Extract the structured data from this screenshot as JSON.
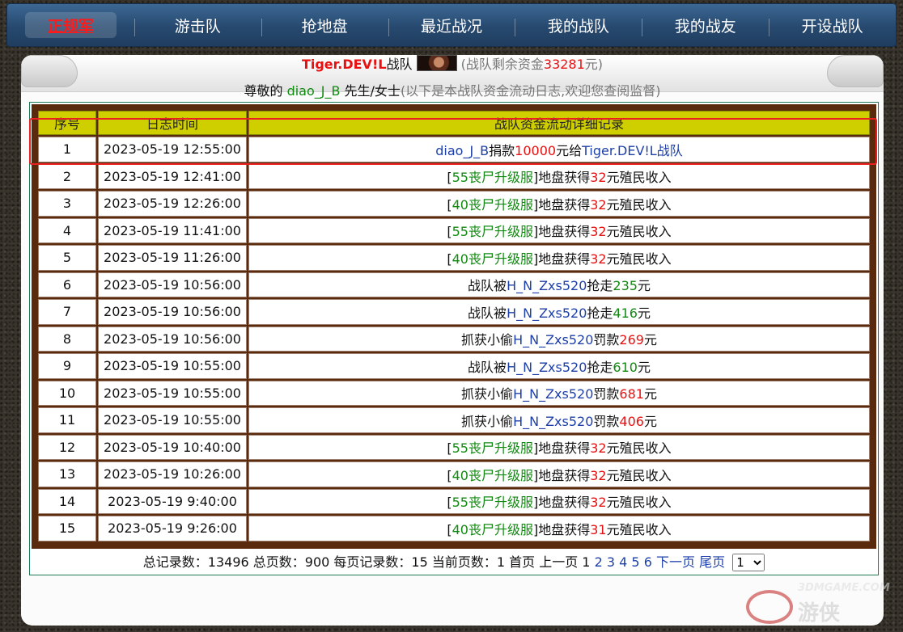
{
  "nav": {
    "items": [
      {
        "label": "正规军",
        "active": true
      },
      {
        "label": "游击队"
      },
      {
        "label": "抢地盘"
      },
      {
        "label": "最近战况"
      },
      {
        "label": "我的战队"
      },
      {
        "label": "我的战友"
      },
      {
        "label": "开设战队"
      }
    ]
  },
  "header": {
    "team_name": "Tiger.DEV!L",
    "team_suffix": "战队",
    "funds_prefix": "(战队剩余资金",
    "funds_value": "33281",
    "funds_suffix": "元)"
  },
  "greeting": {
    "prefix": "尊敬的 ",
    "user": "diao_J_B",
    "mid": " 先生/女士",
    "note": "(以下是本战队资金流动日志,欢迎您查阅监督)"
  },
  "table": {
    "headers": [
      "序号",
      "日志时间",
      "战队资金流动详细记录"
    ],
    "rows": [
      {
        "idx": "1",
        "time": "2023-05-19 12:55:00",
        "parts": [
          {
            "t": "diao_J_B",
            "c": "blue"
          },
          {
            "t": "捐款",
            "c": ""
          },
          {
            "t": "10000",
            "c": "red"
          },
          {
            "t": "元给",
            "c": ""
          },
          {
            "t": "Tiger.DEV!L战队",
            "c": "blue"
          }
        ]
      },
      {
        "idx": "2",
        "time": "2023-05-19 12:41:00",
        "parts": [
          {
            "t": "[",
            "c": ""
          },
          {
            "t": "55丧尸升级服",
            "c": "green"
          },
          {
            "t": "]地盘获得",
            "c": ""
          },
          {
            "t": "32",
            "c": "red"
          },
          {
            "t": "元殖民收入",
            "c": ""
          }
        ]
      },
      {
        "idx": "3",
        "time": "2023-05-19 12:26:00",
        "parts": [
          {
            "t": "[",
            "c": ""
          },
          {
            "t": "40丧尸升级服",
            "c": "green"
          },
          {
            "t": "]地盘获得",
            "c": ""
          },
          {
            "t": "32",
            "c": "red"
          },
          {
            "t": "元殖民收入",
            "c": ""
          }
        ]
      },
      {
        "idx": "4",
        "time": "2023-05-19 11:41:00",
        "parts": [
          {
            "t": "[",
            "c": ""
          },
          {
            "t": "55丧尸升级服",
            "c": "green"
          },
          {
            "t": "]地盘获得",
            "c": ""
          },
          {
            "t": "32",
            "c": "red"
          },
          {
            "t": "元殖民收入",
            "c": ""
          }
        ]
      },
      {
        "idx": "5",
        "time": "2023-05-19 11:26:00",
        "parts": [
          {
            "t": "[",
            "c": ""
          },
          {
            "t": "40丧尸升级服",
            "c": "green"
          },
          {
            "t": "]地盘获得",
            "c": ""
          },
          {
            "t": "32",
            "c": "red"
          },
          {
            "t": "元殖民收入",
            "c": ""
          }
        ]
      },
      {
        "idx": "6",
        "time": "2023-05-19 10:56:00",
        "parts": [
          {
            "t": "战队被",
            "c": ""
          },
          {
            "t": "H_N_Zxs520",
            "c": "blue"
          },
          {
            "t": "抢走",
            "c": ""
          },
          {
            "t": "235",
            "c": "green"
          },
          {
            "t": "元",
            "c": ""
          }
        ]
      },
      {
        "idx": "7",
        "time": "2023-05-19 10:56:00",
        "parts": [
          {
            "t": "战队被",
            "c": ""
          },
          {
            "t": "H_N_Zxs520",
            "c": "blue"
          },
          {
            "t": "抢走",
            "c": ""
          },
          {
            "t": "416",
            "c": "green"
          },
          {
            "t": "元",
            "c": ""
          }
        ]
      },
      {
        "idx": "8",
        "time": "2023-05-19 10:56:00",
        "parts": [
          {
            "t": "抓获小偷",
            "c": ""
          },
          {
            "t": "H_N_Zxs520",
            "c": "blue"
          },
          {
            "t": "罚款",
            "c": ""
          },
          {
            "t": "269",
            "c": "red"
          },
          {
            "t": "元",
            "c": ""
          }
        ]
      },
      {
        "idx": "9",
        "time": "2023-05-19 10:55:00",
        "parts": [
          {
            "t": "战队被",
            "c": ""
          },
          {
            "t": "H_N_Zxs520",
            "c": "blue"
          },
          {
            "t": "抢走",
            "c": ""
          },
          {
            "t": "610",
            "c": "green"
          },
          {
            "t": "元",
            "c": ""
          }
        ]
      },
      {
        "idx": "10",
        "time": "2023-05-19 10:55:00",
        "parts": [
          {
            "t": "抓获小偷",
            "c": ""
          },
          {
            "t": "H_N_Zxs520",
            "c": "blue"
          },
          {
            "t": "罚款",
            "c": ""
          },
          {
            "t": "681",
            "c": "red"
          },
          {
            "t": "元",
            "c": ""
          }
        ]
      },
      {
        "idx": "11",
        "time": "2023-05-19 10:55:00",
        "parts": [
          {
            "t": "抓获小偷",
            "c": ""
          },
          {
            "t": "H_N_Zxs520",
            "c": "blue"
          },
          {
            "t": "罚款",
            "c": ""
          },
          {
            "t": "406",
            "c": "red"
          },
          {
            "t": "元",
            "c": ""
          }
        ]
      },
      {
        "idx": "12",
        "time": "2023-05-19 10:40:00",
        "parts": [
          {
            "t": "[",
            "c": ""
          },
          {
            "t": "55丧尸升级服",
            "c": "green"
          },
          {
            "t": "]地盘获得",
            "c": ""
          },
          {
            "t": "32",
            "c": "red"
          },
          {
            "t": "元殖民收入",
            "c": ""
          }
        ]
      },
      {
        "idx": "13",
        "time": "2023-05-19 10:26:00",
        "parts": [
          {
            "t": "[",
            "c": ""
          },
          {
            "t": "40丧尸升级服",
            "c": "green"
          },
          {
            "t": "]地盘获得",
            "c": ""
          },
          {
            "t": "32",
            "c": "red"
          },
          {
            "t": "元殖民收入",
            "c": ""
          }
        ]
      },
      {
        "idx": "14",
        "time": "2023-05-19 9:40:00",
        "parts": [
          {
            "t": "[",
            "c": ""
          },
          {
            "t": "55丧尸升级服",
            "c": "green"
          },
          {
            "t": "]地盘获得",
            "c": ""
          },
          {
            "t": "32",
            "c": "red"
          },
          {
            "t": "元殖民收入",
            "c": ""
          }
        ]
      },
      {
        "idx": "15",
        "time": "2023-05-19 9:26:00",
        "parts": [
          {
            "t": "[",
            "c": ""
          },
          {
            "t": "40丧尸升级服",
            "c": "green"
          },
          {
            "t": "]地盘获得",
            "c": ""
          },
          {
            "t": "31",
            "c": "red"
          },
          {
            "t": "元殖民收入",
            "c": ""
          }
        ]
      }
    ]
  },
  "pager": {
    "summary": "总记录数：13496 总页数：900 每页记录数：15 当前页数：1 首页 上一页 1",
    "pages": [
      "2",
      "3",
      "4",
      "5",
      "6"
    ],
    "next": "下一页",
    "last": "尾页",
    "select_value": "1"
  },
  "watermark": {
    "top_text": "3DMGAME.COM",
    "big_text": "游侠"
  },
  "colors": {
    "red": "#e81010",
    "blue": "#1d3fa8",
    "green": "#118a11",
    "header_bg": "#cfcf00",
    "frame": "#5a2a0c",
    "nav_bg": "#27496f"
  }
}
